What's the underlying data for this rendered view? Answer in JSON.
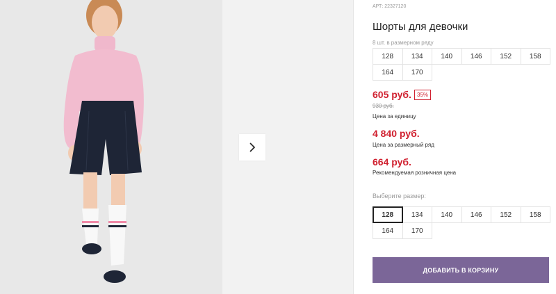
{
  "product": {
    "article_label": "АРТ",
    "article_number": "22327120",
    "title": "Шорты для девочки",
    "series_label": "8 шт. в размерном ряду",
    "series_sizes": [
      "128",
      "134",
      "140",
      "146",
      "152",
      "158",
      "164",
      "170"
    ],
    "price_unit": "605 руб.",
    "discount": "35%",
    "old_price": "930 руб.",
    "price_unit_caption": "Цена за единицу",
    "price_series": "4 840 руб.",
    "price_series_caption": "Цена за размерный ряд",
    "price_retail": "664 руб.",
    "price_retail_caption": "Рекомендуемая розничная цена",
    "choose_size_label": "Выберите размер:",
    "size_options": [
      "128",
      "134",
      "140",
      "146",
      "152",
      "158",
      "164",
      "170"
    ],
    "selected_size": "128",
    "add_to_cart_label": "ДОБАВИТЬ В КОРЗИНУ"
  },
  "colors": {
    "price_red": "#d0202f",
    "cart_button": "#7b6698"
  },
  "icons": {
    "gallery_next": "chevron-right-icon"
  }
}
